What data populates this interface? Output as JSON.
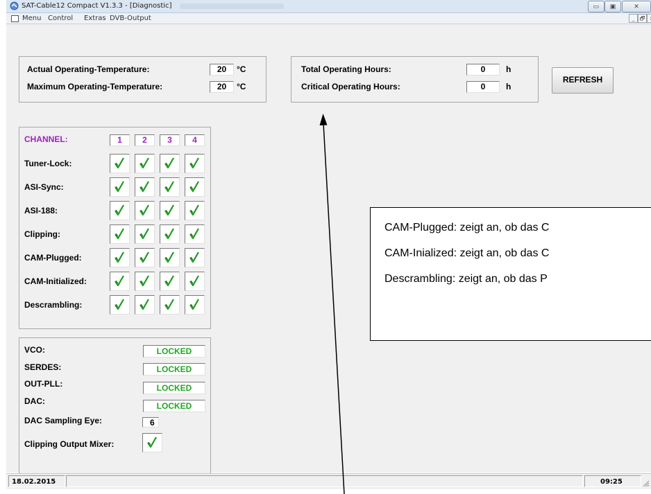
{
  "window": {
    "title": "SAT-Cable12 Compact V1.3.3 - [Diagnostic]",
    "controls": [
      "▭",
      "▣",
      "✕"
    ]
  },
  "menu": {
    "items": [
      "Menu",
      "Control",
      "Extras",
      "DVB-Output"
    ],
    "mdi_controls": [
      "_",
      "🗗",
      "x"
    ]
  },
  "temperature": {
    "actual_label": "Actual Operating-Temperature:",
    "actual_value": "20",
    "max_label": "Maximum Operating-Temperature:",
    "max_value": "20",
    "unit": "°C"
  },
  "hours": {
    "total_label": "Total Operating Hours:",
    "total_value": "0",
    "critical_label": "Critical Operating Hours:",
    "critical_value": "0",
    "unit": "h"
  },
  "refresh_label": "REFRESH",
  "channels": {
    "header_label": "CHANNEL:",
    "numbers": [
      "1",
      "2",
      "3",
      "4"
    ],
    "rows": [
      {
        "label": "Tuner-Lock:",
        "checked": [
          true,
          true,
          true,
          true
        ]
      },
      {
        "label": "ASI-Sync:",
        "checked": [
          true,
          true,
          true,
          true
        ]
      },
      {
        "label": "ASI-188:",
        "checked": [
          true,
          true,
          true,
          true
        ]
      },
      {
        "label": "Clipping:",
        "checked": [
          true,
          true,
          true,
          true
        ]
      },
      {
        "label": "CAM-Plugged:",
        "checked": [
          true,
          true,
          true,
          true
        ]
      },
      {
        "label": "CAM-Initialized:",
        "checked": [
          true,
          true,
          true,
          true
        ]
      },
      {
        "label": "Descrambling:",
        "checked": [
          true,
          true,
          true,
          true
        ]
      }
    ]
  },
  "pll": {
    "vco_label": "VCO:",
    "vco_value": "LOCKED",
    "serdes_label": "SERDES:",
    "serdes_value": "LOCKED",
    "outpll_label": "OUT-PLL:",
    "outpll_value": "LOCKED",
    "dac_label": "DAC:",
    "dac_value": "LOCKED",
    "eye_label": "DAC Sampling Eye:",
    "eye_value": "6",
    "clipping_label": "Clipping Output Mixer:",
    "clipping_checked": true
  },
  "status": {
    "date": "18.02.2015",
    "time": "09:25"
  },
  "annotation": {
    "lines": [
      "CAM-Plugged: zeigt an, ob das C",
      "CAM-Inialized: zeigt an, ob das C",
      "Descrambling: zeigt an, ob das P"
    ]
  },
  "colors": {
    "channel_purple": "#a020c0",
    "locked_green": "#1ea81e",
    "check_green": "#1e9a1e"
  }
}
